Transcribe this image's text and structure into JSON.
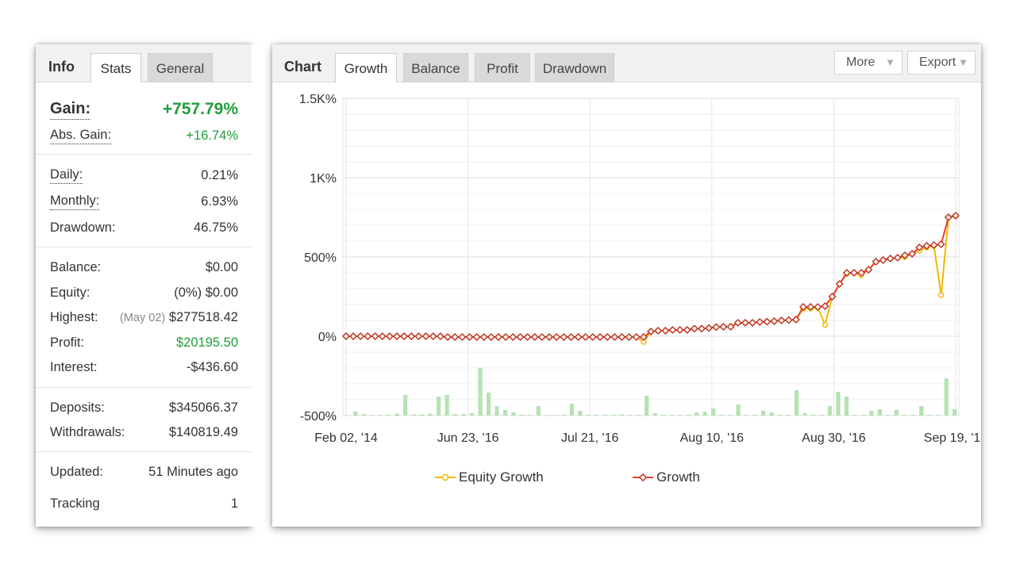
{
  "info": {
    "tab_title": "Info",
    "tabs": [
      {
        "label": "Stats",
        "active": true
      },
      {
        "label": "General",
        "active": false
      }
    ],
    "gain": {
      "label": "Gain:",
      "value": "+757.79%"
    },
    "abs_gain": {
      "label": "Abs. Gain:",
      "value": "+16.74%"
    },
    "daily": {
      "label": "Daily:",
      "value": "0.21%"
    },
    "monthly": {
      "label": "Monthly:",
      "value": "6.93%"
    },
    "drawdown": {
      "label": "Drawdown:",
      "value": "46.75%"
    },
    "balance": {
      "label": "Balance:",
      "value": "$0.00"
    },
    "equity": {
      "label": "Equity:",
      "value": "(0%) $0.00"
    },
    "highest": {
      "label": "Highest:",
      "date": "(May 02)",
      "value": "$277518.42"
    },
    "profit": {
      "label": "Profit:",
      "value": "$20195.50"
    },
    "interest": {
      "label": "Interest:",
      "value": "-$436.60"
    },
    "deposits": {
      "label": "Deposits:",
      "value": "$345066.37"
    },
    "withdrawals": {
      "label": "Withdrawals:",
      "value": "$140819.49"
    },
    "updated": {
      "label": "Updated:",
      "value": "51 Minutes ago"
    },
    "tracking": {
      "label": "Tracking",
      "value": "1"
    }
  },
  "chart_panel": {
    "tab_title": "Chart",
    "tabs": [
      {
        "label": "Growth",
        "active": true
      },
      {
        "label": "Balance",
        "active": false
      },
      {
        "label": "Profit",
        "active": false
      },
      {
        "label": "Drawdown",
        "active": false
      }
    ],
    "more_label": "More",
    "export_label": "Export",
    "caret_icon": "▼"
  },
  "colors": {
    "equity_line": "#f2b705",
    "growth_line": "#e8412a",
    "growth_marker": "#c0392b",
    "bars": "#b5e2b5",
    "positive": "#1f9e3a"
  },
  "chart_data": {
    "type": "line",
    "x_ticks": [
      "Feb 02, '14",
      "Jun 23, '16",
      "Jul 21, '16",
      "Aug 10, '16",
      "Aug 30, '16",
      "Sep 19, '16"
    ],
    "y_ticks": [
      "1.5K%",
      "1K%",
      "500%",
      "0%",
      "-500%"
    ],
    "ylim": [
      -500,
      1500
    ],
    "unit": "%",
    "grid": true,
    "legend_position": "bottom",
    "series": [
      {
        "name": "Equity Growth",
        "color": "#f2b705",
        "values": [
          0,
          0,
          0,
          0,
          0,
          0,
          0,
          0,
          0,
          0,
          0,
          0,
          0,
          0,
          -5,
          -5,
          -5,
          -5,
          -5,
          -5,
          -5,
          -5,
          -5,
          -5,
          -5,
          -5,
          -5,
          -5,
          -5,
          -5,
          -5,
          -5,
          -5,
          -5,
          -5,
          -5,
          -5,
          -5,
          -5,
          -5,
          -5,
          -35,
          30,
          35,
          35,
          40,
          40,
          40,
          48,
          48,
          52,
          58,
          60,
          60,
          85,
          85,
          85,
          90,
          92,
          95,
          100,
          102,
          105,
          175,
          175,
          180,
          72,
          250,
          330,
          395,
          400,
          385,
          420,
          470,
          480,
          490,
          495,
          500,
          520,
          540,
          560,
          570,
          260,
          750,
          760
        ]
      },
      {
        "name": "Growth",
        "color": "#e8412a",
        "values": [
          0,
          0,
          0,
          0,
          0,
          0,
          0,
          0,
          0,
          0,
          0,
          0,
          0,
          0,
          -5,
          -5,
          -5,
          -5,
          -5,
          -5,
          -5,
          -5,
          -5,
          -5,
          -5,
          -5,
          -5,
          -5,
          -5,
          -5,
          -5,
          -5,
          -5,
          -5,
          -5,
          -5,
          -5,
          -5,
          -5,
          -5,
          -5,
          -5,
          30,
          35,
          35,
          40,
          40,
          40,
          48,
          48,
          52,
          58,
          60,
          60,
          85,
          85,
          85,
          90,
          92,
          95,
          100,
          102,
          105,
          185,
          185,
          185,
          190,
          250,
          330,
          400,
          400,
          400,
          420,
          470,
          480,
          490,
          495,
          510,
          520,
          560,
          570,
          575,
          580,
          750,
          760
        ]
      },
      {
        "name": "bars",
        "values": [
          3,
          25,
          9,
          4,
          5,
          5,
          12,
          130,
          8,
          7,
          12,
          120,
          130,
          10,
          10,
          15,
          300,
          145,
          60,
          35,
          20,
          6,
          5,
          60,
          4,
          4,
          5,
          75,
          30,
          5,
          5,
          5,
          5,
          8,
          5,
          5,
          125,
          15,
          5,
          5,
          5,
          5,
          20,
          25,
          45,
          5,
          5,
          70,
          5,
          5,
          30,
          20,
          5,
          5,
          160,
          15,
          5,
          5,
          60,
          150,
          120,
          5,
          5,
          30,
          40,
          5,
          35,
          5,
          5,
          60,
          5,
          5,
          235,
          40
        ]
      }
    ]
  }
}
